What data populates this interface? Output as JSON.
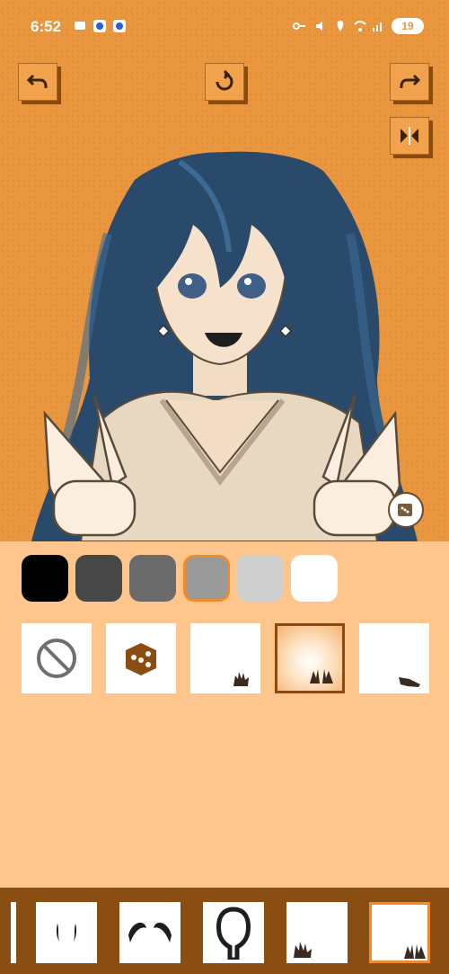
{
  "status_bar": {
    "time": "6:52",
    "battery": "19",
    "icons": [
      "message-icon",
      "app-icon",
      "app-icon",
      "key-icon",
      "mute-icon",
      "location-icon",
      "wifi-icon",
      "signal-icon"
    ]
  },
  "toolbar": {
    "buttons": [
      "undo-icon",
      "reset-icon",
      "redo-icon",
      "mirror-icon"
    ]
  },
  "colors": {
    "swatches": [
      "#000000",
      "#474747",
      "#6b6b6b",
      "#9a9a9a",
      "#cfcfcf",
      "#ffffff"
    ],
    "selected_index": 3,
    "accent": "#f08a2a",
    "panel_background": "#fec68c",
    "canvas_background": "#e9963f",
    "bar_background": "#8a4e12"
  },
  "pose_options": {
    "items": [
      "none-icon",
      "random-dice-icon",
      "wave-hand-icon",
      "peace-hands-icon",
      "pointing-hand-icon"
    ],
    "selected_index": 3
  },
  "categories": {
    "items": [
      "eyebrows-thin-icon",
      "eyebrows-thick-icon",
      "hood-outline-icon",
      "wave-hand-icon",
      "peace-hands-icon"
    ],
    "selected_index": 4
  }
}
